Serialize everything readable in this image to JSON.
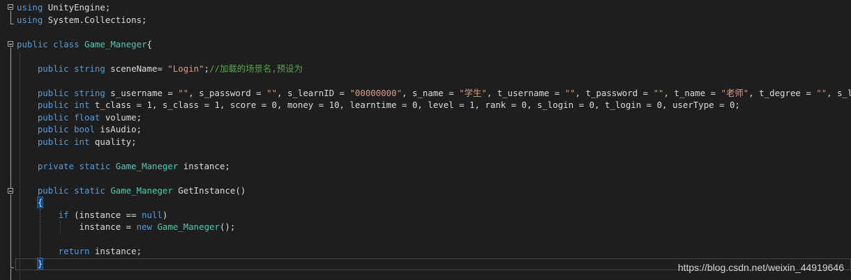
{
  "colors": {
    "background": "#1e1e1e",
    "keyword": "#569cd6",
    "type": "#4ec9b0",
    "string": "#d69d85",
    "comment": "#57a64a",
    "text": "#dcdcdc"
  },
  "editor": {
    "lines": [
      [
        {
          "t": "using",
          "c": "kw"
        },
        {
          "t": " UnityEngine;",
          "c": "pl"
        }
      ],
      [
        {
          "t": "using",
          "c": "kw"
        },
        {
          "t": " System.Collections;",
          "c": "pl"
        }
      ],
      [],
      [
        {
          "t": "public",
          "c": "kw"
        },
        {
          "t": " ",
          "c": "pl"
        },
        {
          "t": "class",
          "c": "kw"
        },
        {
          "t": " ",
          "c": "pl"
        },
        {
          "t": "Game_Maneger",
          "c": "ty"
        },
        {
          "t": "{",
          "c": "pl"
        }
      ],
      [],
      [
        {
          "t": "    public",
          "c": "kw"
        },
        {
          "t": " ",
          "c": "pl"
        },
        {
          "t": "string",
          "c": "kw"
        },
        {
          "t": " sceneName= ",
          "c": "pl"
        },
        {
          "t": "\"Login\"",
          "c": "st"
        },
        {
          "t": ";",
          "c": "pl"
        },
        {
          "t": "//加载的场景名,预设为",
          "c": "cm"
        }
      ],
      [],
      [
        {
          "t": "    public",
          "c": "kw"
        },
        {
          "t": " ",
          "c": "pl"
        },
        {
          "t": "string",
          "c": "kw"
        },
        {
          "t": " s_username = ",
          "c": "pl"
        },
        {
          "t": "\"\"",
          "c": "st"
        },
        {
          "t": ", s_password = ",
          "c": "pl"
        },
        {
          "t": "\"\"",
          "c": "st"
        },
        {
          "t": ", s_learnID = ",
          "c": "pl"
        },
        {
          "t": "\"00000000\"",
          "c": "st"
        },
        {
          "t": ", s_name = ",
          "c": "pl"
        },
        {
          "t": "\"学生\"",
          "c": "st"
        },
        {
          "t": ", t_username = ",
          "c": "pl"
        },
        {
          "t": "\"\"",
          "c": "st"
        },
        {
          "t": ", t_password = ",
          "c": "pl"
        },
        {
          "t": "\"\"",
          "c": "st"
        },
        {
          "t": ", t_name = ",
          "c": "pl"
        },
        {
          "t": "\"老师\"",
          "c": "st"
        },
        {
          "t": ", t_degree = ",
          "c": "pl"
        },
        {
          "t": "\"\"",
          "c": "st"
        },
        {
          "t": ", s_logint",
          "c": "pl"
        }
      ],
      [
        {
          "t": "    public",
          "c": "kw"
        },
        {
          "t": " ",
          "c": "pl"
        },
        {
          "t": "int",
          "c": "kw"
        },
        {
          "t": " t_class = 1, s_class = 1, score = 0, money = 10, learntime = 0, level = 1, rank = 0, s_login = 0, t_login = 0, userType = 0;",
          "c": "pl"
        }
      ],
      [
        {
          "t": "    public",
          "c": "kw"
        },
        {
          "t": " ",
          "c": "pl"
        },
        {
          "t": "float",
          "c": "kw"
        },
        {
          "t": " volume;",
          "c": "pl"
        }
      ],
      [
        {
          "t": "    public",
          "c": "kw"
        },
        {
          "t": " ",
          "c": "pl"
        },
        {
          "t": "bool",
          "c": "kw"
        },
        {
          "t": " isAudio;",
          "c": "pl"
        }
      ],
      [
        {
          "t": "    public",
          "c": "kw"
        },
        {
          "t": " ",
          "c": "pl"
        },
        {
          "t": "int",
          "c": "kw"
        },
        {
          "t": " quality;",
          "c": "pl"
        }
      ],
      [],
      [
        {
          "t": "    private",
          "c": "kw"
        },
        {
          "t": " ",
          "c": "pl"
        },
        {
          "t": "static",
          "c": "kw"
        },
        {
          "t": " ",
          "c": "pl"
        },
        {
          "t": "Game_Maneger",
          "c": "ty"
        },
        {
          "t": " instance;",
          "c": "pl"
        }
      ],
      [],
      [
        {
          "t": "    public",
          "c": "kw"
        },
        {
          "t": " ",
          "c": "pl"
        },
        {
          "t": "static",
          "c": "kw"
        },
        {
          "t": " ",
          "c": "pl"
        },
        {
          "t": "Game_Maneger",
          "c": "ty"
        },
        {
          "t": " GetInstance()",
          "c": "pl"
        }
      ],
      [
        {
          "t": "    ",
          "c": "pl"
        },
        {
          "t": "{",
          "c": "brace"
        }
      ],
      [
        {
          "t": "        if",
          "c": "kw"
        },
        {
          "t": " (instance == ",
          "c": "pl"
        },
        {
          "t": "null",
          "c": "kw"
        },
        {
          "t": ")",
          "c": "pl"
        }
      ],
      [
        {
          "t": "            instance = ",
          "c": "pl"
        },
        {
          "t": "new",
          "c": "kw"
        },
        {
          "t": " ",
          "c": "pl"
        },
        {
          "t": "Game_Maneger",
          "c": "ty"
        },
        {
          "t": "();",
          "c": "pl"
        }
      ],
      [],
      [
        {
          "t": "        return",
          "c": "kw"
        },
        {
          "t": " instance;",
          "c": "pl"
        }
      ],
      [
        {
          "t": "    ",
          "c": "pl"
        },
        {
          "t": "}",
          "c": "brace"
        }
      ]
    ]
  },
  "watermark": "https://blog.csdn.net/weixin_44919646"
}
